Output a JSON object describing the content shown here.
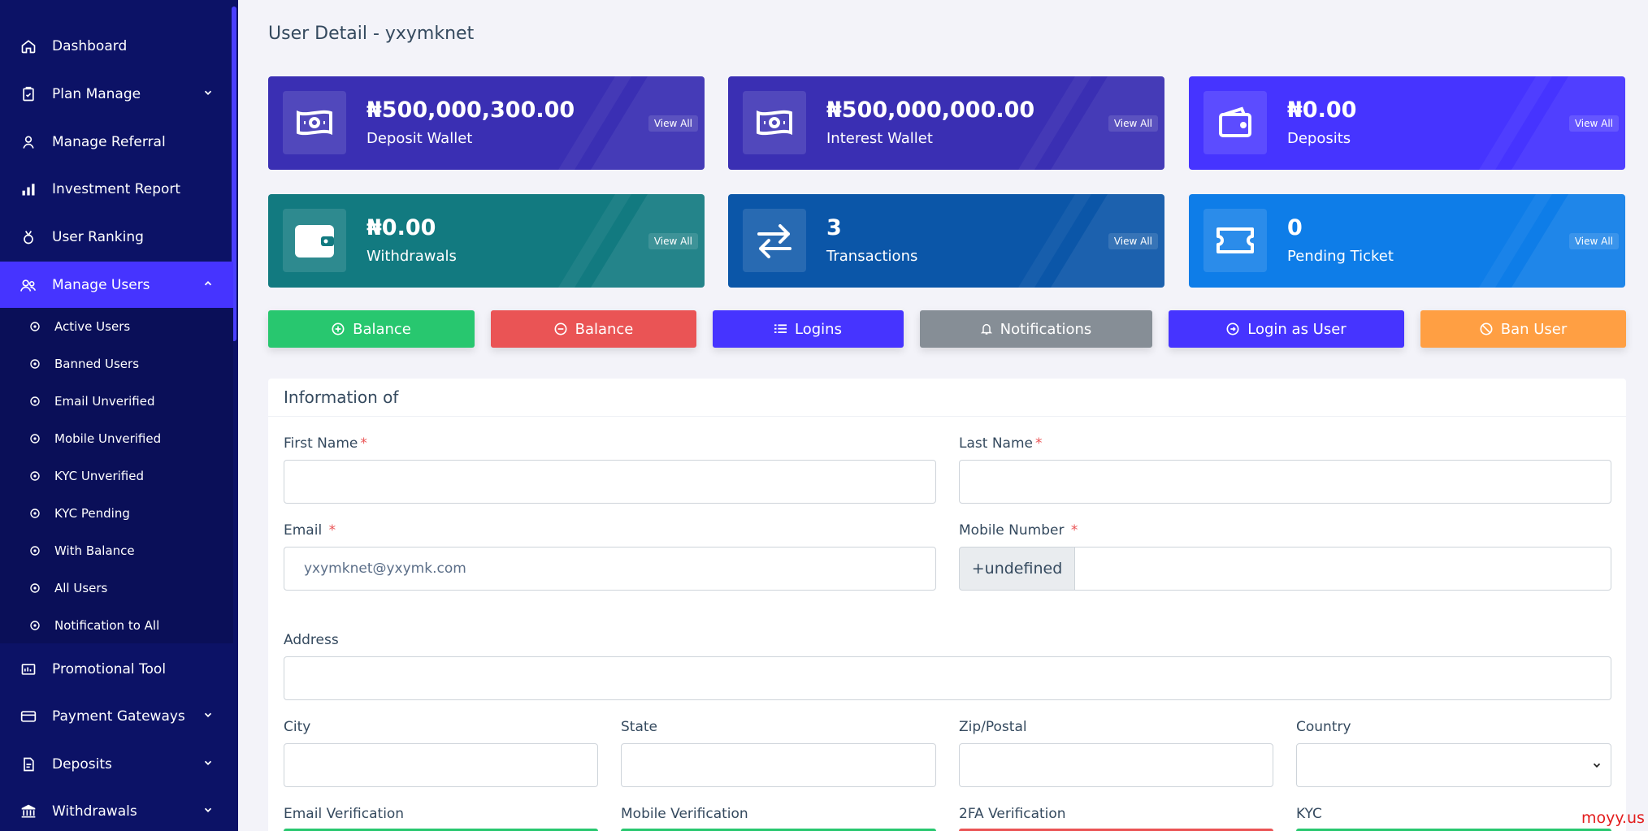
{
  "sidebar": {
    "items": [
      {
        "label": "Dashboard",
        "icon": "home-icon"
      },
      {
        "label": "Plan Manage",
        "icon": "clipboard-icon",
        "caret": "chevron-down"
      },
      {
        "label": "Manage Referral",
        "icon": "referral-icon"
      },
      {
        "label": "Investment Report",
        "icon": "bar-chart-icon"
      },
      {
        "label": "User Ranking",
        "icon": "medal-icon"
      },
      {
        "label": "Manage Users",
        "icon": "users-icon",
        "caret": "chevron-up",
        "active": true
      },
      {
        "label": "Promotional Tool",
        "icon": "promo-icon"
      },
      {
        "label": "Payment Gateways",
        "icon": "credit-card-icon",
        "caret": "chevron-down"
      },
      {
        "label": "Deposits",
        "icon": "deposit-icon",
        "caret": "chevron-down"
      },
      {
        "label": "Withdrawals",
        "icon": "bank-icon",
        "caret": "chevron-down"
      }
    ],
    "submenu": [
      {
        "label": "Active Users"
      },
      {
        "label": "Banned Users"
      },
      {
        "label": "Email Unverified"
      },
      {
        "label": "Mobile Unverified"
      },
      {
        "label": "KYC Unverified"
      },
      {
        "label": "KYC Pending"
      },
      {
        "label": "With Balance"
      },
      {
        "label": "All Users"
      },
      {
        "label": "Notification to All"
      }
    ]
  },
  "page": {
    "title": "User Detail - yxymknet"
  },
  "widgets": [
    {
      "amount": "₦500,000,300.00",
      "label": "Deposit Wallet",
      "view_all": "View All",
      "icon": "money-icon",
      "color": "#3a2fb3"
    },
    {
      "amount": "₦500,000,000.00",
      "label": "Interest Wallet",
      "view_all": "View All",
      "icon": "money-icon",
      "color": "#3a2fb3"
    },
    {
      "amount": "₦0.00",
      "label": "Deposits",
      "view_all": "View All",
      "icon": "wallet-icon",
      "color": "#4634ff"
    },
    {
      "amount": "₦0.00",
      "label": "Withdrawals",
      "view_all": "View All",
      "icon": "wallet-icon",
      "color": "#127a80"
    },
    {
      "amount": "3",
      "label": "Transactions",
      "view_all": "View All",
      "icon": "exchange-icon",
      "color": "#0b56a8"
    },
    {
      "amount": "0",
      "label": "Pending Ticket",
      "view_all": "View All",
      "icon": "ticket-icon",
      "color": "#0e7de8"
    }
  ],
  "actions": [
    {
      "label": "Balance",
      "icon": "plus-circle-icon",
      "color": "#28c76f"
    },
    {
      "label": "Balance",
      "icon": "minus-circle-icon",
      "color": "#ea5455"
    },
    {
      "label": "Logins",
      "icon": "list-icon",
      "color": "#4634ff"
    },
    {
      "label": "Notifications",
      "icon": "bell-icon",
      "color": "#868e96"
    },
    {
      "label": "Login as User",
      "icon": "login-icon",
      "color": "#4634ff"
    },
    {
      "label": "Ban User",
      "icon": "ban-icon",
      "color": "#ff9f43"
    }
  ],
  "form": {
    "header": "Information of",
    "first_name": {
      "label": "First Name",
      "required": "*",
      "value": ""
    },
    "last_name": {
      "label": "Last Name",
      "required": "*",
      "value": ""
    },
    "email": {
      "label": "Email",
      "required": "*",
      "value": "yxymknet@yxymk.com"
    },
    "mobile": {
      "label": "Mobile Number",
      "required": "*",
      "prefix": "+undefined",
      "value": ""
    },
    "address": {
      "label": "Address",
      "value": ""
    },
    "city": {
      "label": "City",
      "value": ""
    },
    "state": {
      "label": "State",
      "value": ""
    },
    "zip": {
      "label": "Zip/Postal",
      "value": ""
    },
    "country": {
      "label": "Country",
      "value": ""
    },
    "email_verification": {
      "label": "Email Verification"
    },
    "mobile_verification": {
      "label": "Mobile Verification"
    },
    "twofa_verification": {
      "label": "2FA Verification"
    },
    "kyc": {
      "label": "KYC"
    }
  },
  "watermark": "moyy.us"
}
